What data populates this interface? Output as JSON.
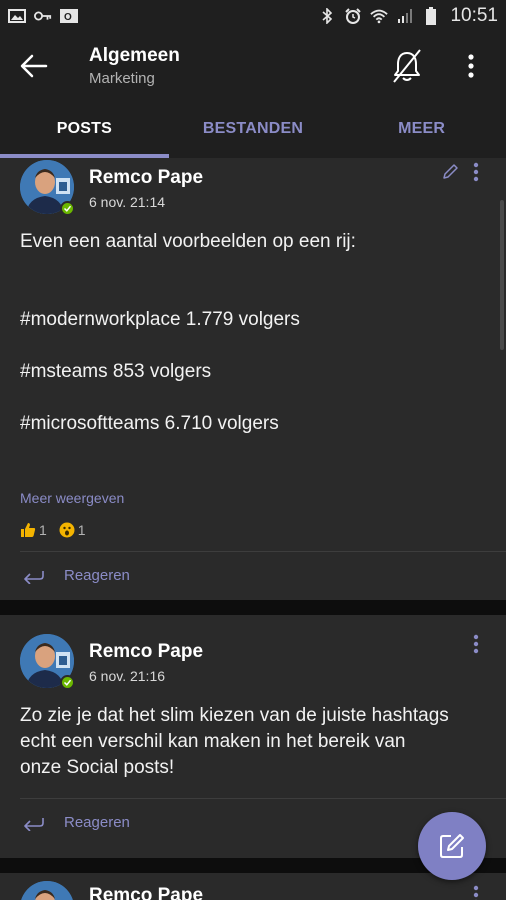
{
  "status_bar": {
    "time": "10:51",
    "left_icons": [
      "image-icon",
      "key-icon",
      "outlook-icon"
    ],
    "right_icons": [
      "bluetooth-icon",
      "alarm-icon",
      "wifi-icon",
      "signal-icon",
      "battery-icon"
    ]
  },
  "header": {
    "title": "Algemeen",
    "subtitle": "Marketing",
    "back_icon": "arrow-left-icon",
    "notifications_icon": "bell-off-icon",
    "more_icon": "more-vertical-icon"
  },
  "tabs": [
    {
      "label": "POSTS",
      "active": true
    },
    {
      "label": "BESTANDEN",
      "active": false
    },
    {
      "label": "MEER",
      "active": false
    }
  ],
  "posts": [
    {
      "author": "Remco Pape",
      "timestamp": "6 nov. 21:14",
      "lines": [
        "Even een aantal voorbeelden op een rij:",
        "#modernworkplace 1.779 volgers",
        "#msteams 853 volgers",
        "#microsoftteams 6.710 volgers"
      ],
      "see_more": "Meer weergeven",
      "reactions": [
        {
          "icon": "thumbs-up-icon",
          "count": "1"
        },
        {
          "icon": "surprised-icon",
          "count": "1"
        }
      ],
      "reply_label": "Reageren"
    },
    {
      "author": "Remco Pape",
      "timestamp": "6 nov. 21:16",
      "lines": [
        "Zo zie je dat het slim kiezen van de juiste hashtags",
        "echt een verschil kan maken in het bereik van",
        "onze Social posts!"
      ],
      "reply_label": "Reageren"
    },
    {
      "author": "Remco Pape"
    }
  ],
  "fab_icon": "compose-icon",
  "colors": {
    "accent": "#8b8cc7",
    "fab": "#7f80c4",
    "background": "#0d0d0d",
    "card": "#2a2a2a",
    "bar": "#1f1f1f",
    "presence": "#6bb700"
  }
}
